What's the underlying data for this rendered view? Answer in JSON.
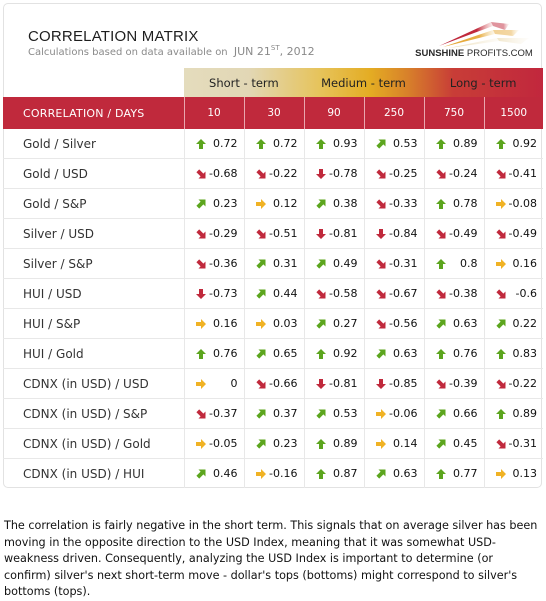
{
  "header": {
    "title": "CORRELATION MATRIX",
    "subtitle_prefix": "Calculations based on data available on",
    "date_month_day": "JUN 21",
    "date_suffix": "ST",
    "date_year": ", 2012",
    "logo_bold": "SUNSHINE",
    "logo_regular": " PROFITS.COM"
  },
  "terms": [
    "Short - term",
    "Medium - term",
    "Long - term"
  ],
  "table": {
    "label_header": "CORRELATION / DAYS",
    "columns": [
      "10",
      "30",
      "90",
      "250",
      "750",
      "1500"
    ],
    "rows": [
      {
        "label": "Gold / Silver",
        "values": [
          "0.72",
          "0.72",
          "0.93",
          "0.53",
          "0.89",
          "0.92"
        ],
        "arrows": [
          "up",
          "up",
          "up",
          "up-right",
          "up",
          "up"
        ]
      },
      {
        "label": "Gold / USD",
        "values": [
          "-0.68",
          "-0.22",
          "-0.78",
          "-0.25",
          "-0.24",
          "-0.41"
        ],
        "arrows": [
          "down-right",
          "down-right",
          "down",
          "down-right",
          "down-right",
          "down-right"
        ]
      },
      {
        "label": "Gold / S&P",
        "values": [
          "0.23",
          "0.12",
          "0.38",
          "-0.33",
          "0.78",
          "-0.08"
        ],
        "arrows": [
          "up-right",
          "right",
          "up-right",
          "down-right",
          "up",
          "right"
        ]
      },
      {
        "label": "Silver / USD",
        "values": [
          "-0.29",
          "-0.51",
          "-0.81",
          "-0.84",
          "-0.49",
          "-0.49"
        ],
        "arrows": [
          "down-right",
          "down-right",
          "down",
          "down",
          "down-right",
          "down-right"
        ]
      },
      {
        "label": "Silver / S&P",
        "values": [
          "-0.36",
          "0.31",
          "0.49",
          "-0.31",
          "0.8",
          "0.16"
        ],
        "arrows": [
          "down-right",
          "up-right",
          "up-right",
          "down-right",
          "up",
          "right"
        ]
      },
      {
        "label": "HUI / USD",
        "values": [
          "-0.73",
          "0.44",
          "-0.58",
          "-0.67",
          "-0.38",
          "-0.6"
        ],
        "arrows": [
          "down",
          "up-right",
          "down-right",
          "down-right",
          "down-right",
          "down-right"
        ]
      },
      {
        "label": "HUI / S&P",
        "values": [
          "0.16",
          "0.03",
          "0.27",
          "-0.56",
          "0.63",
          "0.22"
        ],
        "arrows": [
          "right",
          "right",
          "up-right",
          "down-right",
          "up-right",
          "up-right"
        ]
      },
      {
        "label": "HUI / Gold",
        "values": [
          "0.76",
          "0.65",
          "0.92",
          "0.63",
          "0.76",
          "0.83"
        ],
        "arrows": [
          "up",
          "up-right",
          "up",
          "up-right",
          "up",
          "up"
        ]
      },
      {
        "label": "CDNX (in USD) / USD",
        "values": [
          "0",
          "-0.66",
          "-0.81",
          "-0.85",
          "-0.39",
          "-0.22"
        ],
        "arrows": [
          "right",
          "down-right",
          "down",
          "down",
          "down-right",
          "down-right"
        ]
      },
      {
        "label": "CDNX (in USD) / S&P",
        "values": [
          "-0.37",
          "0.37",
          "0.53",
          "-0.06",
          "0.66",
          "0.89"
        ],
        "arrows": [
          "down-right",
          "up-right",
          "up-right",
          "right",
          "up-right",
          "up"
        ]
      },
      {
        "label": "CDNX (in USD) / Gold",
        "values": [
          "-0.05",
          "0.23",
          "0.89",
          "0.14",
          "0.45",
          "-0.31"
        ],
        "arrows": [
          "right",
          "up-right",
          "up",
          "right",
          "up-right",
          "down-right"
        ]
      },
      {
        "label": "CDNX (in USD) / HUI",
        "values": [
          "0.46",
          "-0.16",
          "0.87",
          "0.63",
          "0.77",
          "0.13"
        ],
        "arrows": [
          "up-right",
          "right",
          "up",
          "up-right",
          "up",
          "right"
        ]
      }
    ]
  },
  "arrow_colors": {
    "up": "#5ca51e",
    "up-right": "#5ca51e",
    "right": "#f0b224",
    "down-right": "#c0293c",
    "down": "#c0293c"
  },
  "colors": {
    "header_red": "#c0293c"
  },
  "description": "The correlation is fairly negative in the short term. This signals that on average silver has been moving in the opposite direction to the USD Index, meaning that it was somewhat USD-weakness driven. Consequently, analyzing the USD Index is important to determine (or confirm) silver's next short-term move - dollar's tops (bottoms) might correspond to silver's bottoms (tops)."
}
